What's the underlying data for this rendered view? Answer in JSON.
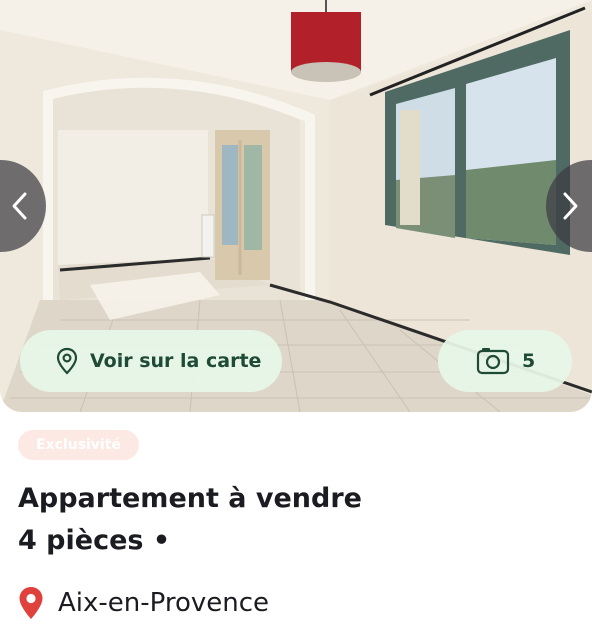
{
  "gallery": {
    "prev_icon": "chevron-left-icon",
    "next_icon": "chevron-right-icon",
    "map_button": {
      "icon": "map-pin-outline-icon",
      "label": "Voir sur la carte"
    },
    "photos_button": {
      "icon": "camera-icon",
      "count": "5"
    }
  },
  "listing": {
    "badge": "Exclusivité",
    "title_line1": "Appartement à vendre",
    "title_line2": "4 pièces •",
    "location": {
      "icon": "location-pin-icon",
      "city": "Aix-en-Provence"
    }
  },
  "colors": {
    "accent_text": "#1f4a36",
    "pill_bg": "#e8f6e8",
    "badge_bg": "#fde9e4",
    "pin": "#e0413c"
  }
}
